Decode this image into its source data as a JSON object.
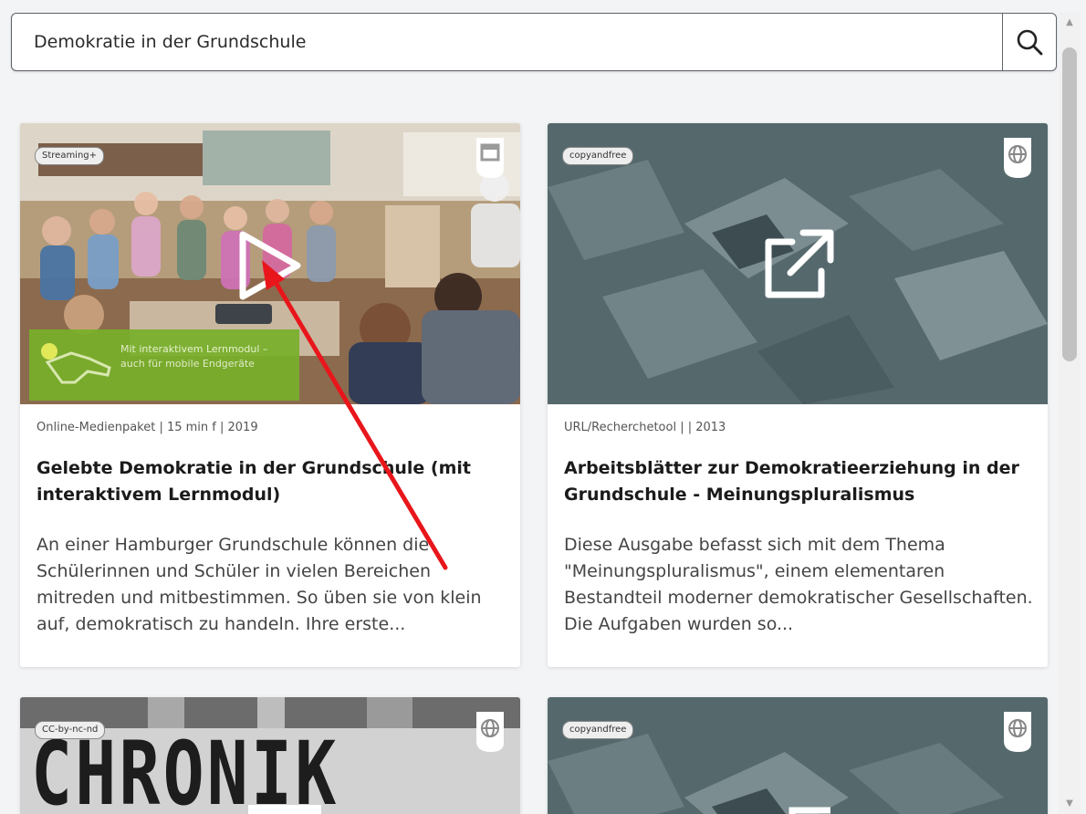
{
  "search": {
    "value": "Demokratie in der Grundschule"
  },
  "cards": [
    {
      "badge": "Streaming+",
      "type_icon": "media-package-icon",
      "overlay": "Mit interaktivem Lernmodul – auch für mobile Endgeräte",
      "meta": "Online-Medienpaket | 15 min f | 2019",
      "title": "Gelebte Demokratie in der Grundschule (mit interaktivem Lernmodul)",
      "description": "An einer Hamburger Grundschule können die Schülerinnen und Schüler in vielen Bereichen mitreden und mitbestimmen. So üben sie von klein auf, demokratisch zu handeln. Ihre erste..."
    },
    {
      "badge": "copyandfree",
      "type_icon": "globe-icon",
      "meta": "URL/Recherchetool | | 2013",
      "title": "Arbeitsblätter zur Demokratieerziehung in der Grundschule - Meinungspluralismus",
      "description": "Diese Ausgabe befasst sich mit dem Thema \"Meinungspluralismus\", einem elementaren Bestandteil moderner demokratischer Gesellschaften. Die Aufgaben wurden so..."
    },
    {
      "badge": "CC-by-nc-nd",
      "type_icon": "globe-icon",
      "thumb_text": "CHRONIK"
    },
    {
      "badge": "copyandfree",
      "type_icon": "globe-icon"
    }
  ],
  "colors": {
    "annotation_arrow": "#e8161b",
    "lernmodul_green": "#78b02a",
    "slate_bg": "#55696d"
  }
}
